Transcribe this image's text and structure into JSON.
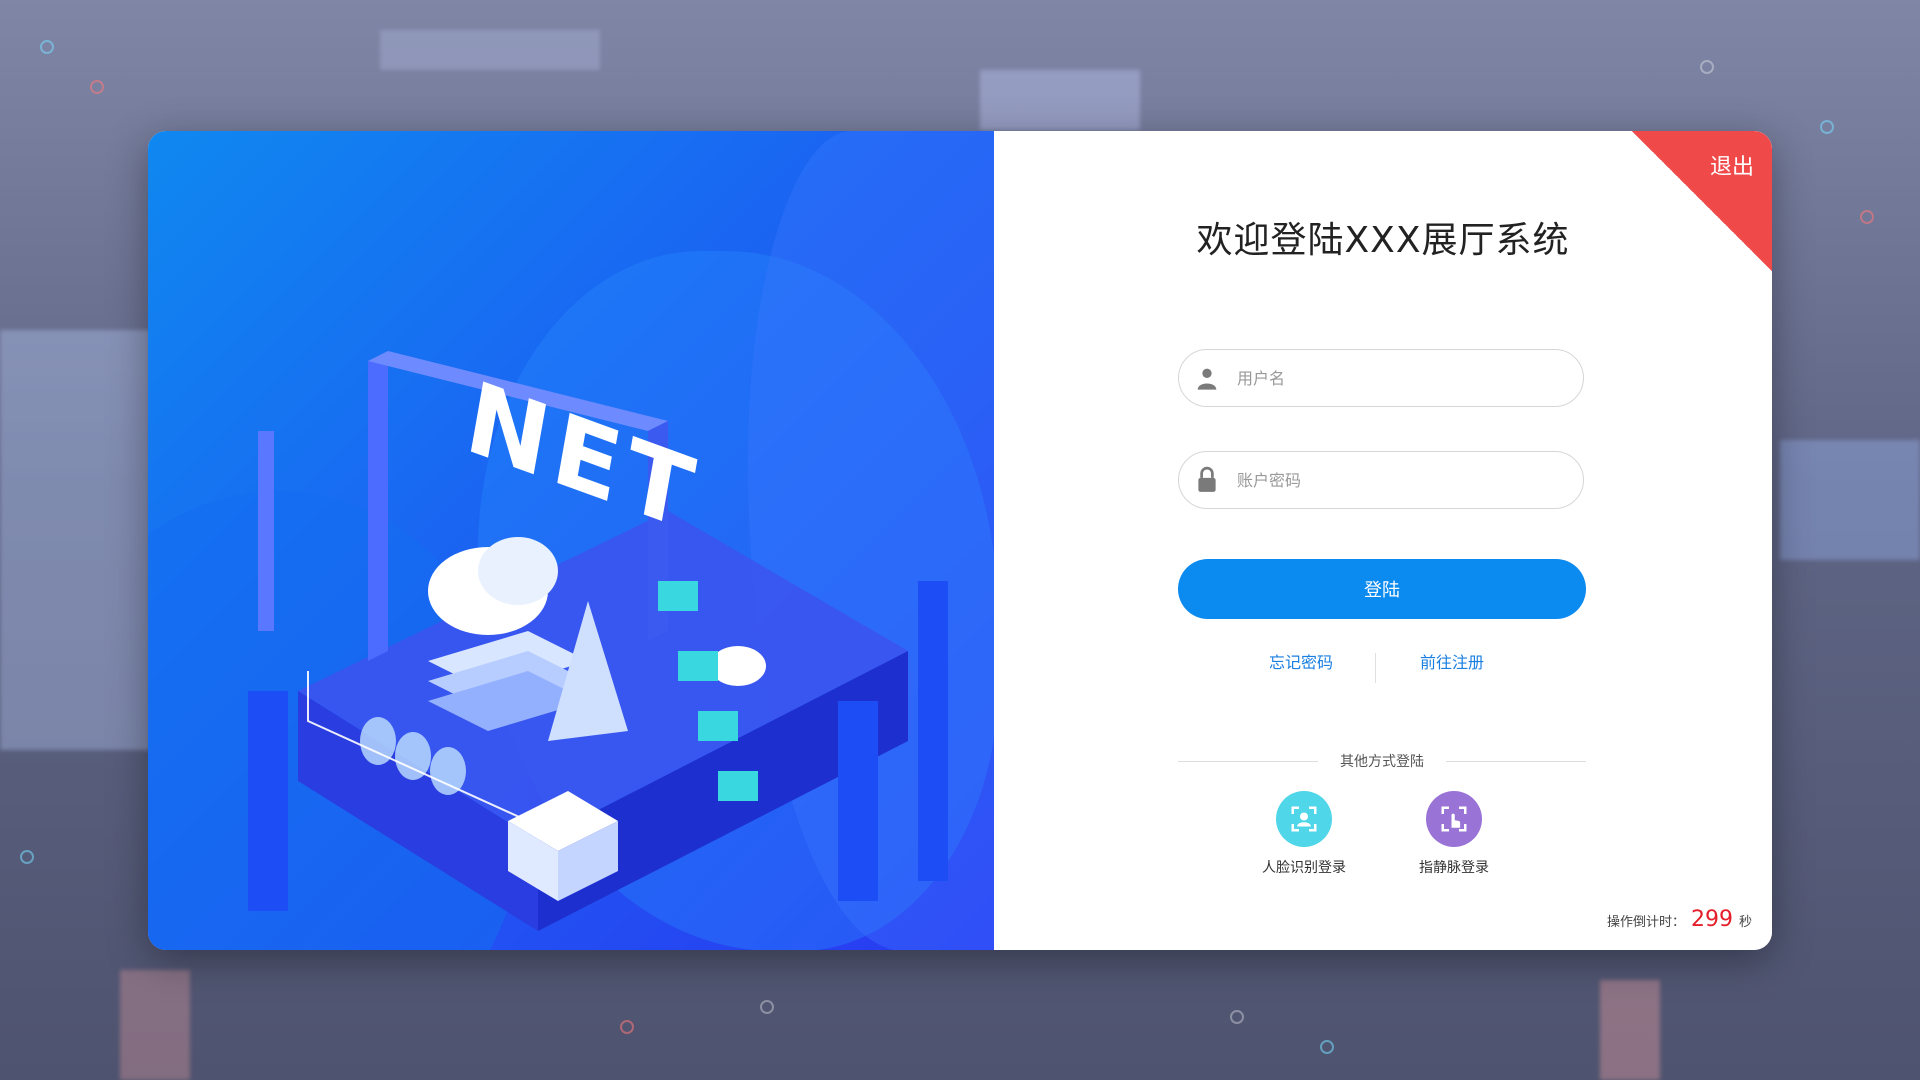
{
  "window": {
    "exit_label": "退出"
  },
  "header": {
    "title": "欢迎登陆XXX展厅系统"
  },
  "form": {
    "username_placeholder": "用户名",
    "password_placeholder": "账户密码",
    "login_label": "登陆"
  },
  "links": {
    "forgot": "忘记密码",
    "register": "前往注册"
  },
  "other_login": {
    "label": "其他方式登陆",
    "methods": [
      {
        "label": "人脸识别登录",
        "icon": "face-scan-icon",
        "color": "#4fd6e8"
      },
      {
        "label": "指静脉登录",
        "icon": "finger-vein-icon",
        "color": "#9a73d6"
      }
    ]
  },
  "countdown": {
    "label": "操作倒计时：",
    "value": "299",
    "unit": "秒"
  },
  "illustration": {
    "text": "NET"
  },
  "colors": {
    "primary": "#0b8af0",
    "accent_red": "#f0494a",
    "countdown_red": "#e51e2b"
  }
}
